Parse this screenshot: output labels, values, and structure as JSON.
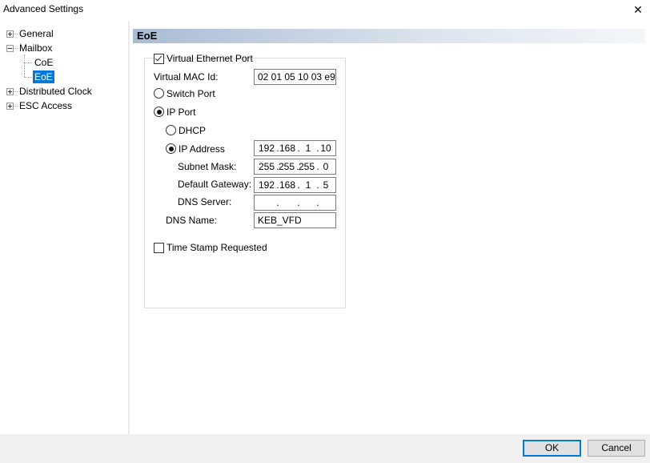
{
  "window": {
    "title": "Advanced Settings",
    "close_glyph": "✕"
  },
  "tree": {
    "general": "General",
    "mailbox": "Mailbox",
    "coe": "CoE",
    "eoe": "EoE",
    "distributed_clock": "Distributed Clock",
    "esc_access": "ESC Access"
  },
  "panel": {
    "header": "EoE"
  },
  "form": {
    "virtual_ethernet_port": "Virtual Ethernet Port",
    "virtual_mac_label": "Virtual MAC Id:",
    "virtual_mac_value": "02 01 05 10 03 e9",
    "switch_port": "Switch Port",
    "ip_port": "IP Port",
    "dhcp": "DHCP",
    "ip_address": "IP Address",
    "ip_address_value": [
      "192",
      "168",
      "1",
      "10"
    ],
    "subnet_mask_label": "Subnet Mask:",
    "subnet_mask_value": [
      "255",
      "255",
      "255",
      "0"
    ],
    "default_gateway_label": "Default Gateway:",
    "default_gateway_value": [
      "192",
      "168",
      "1",
      "5"
    ],
    "dns_server_label": "DNS Server:",
    "dns_server_value": [
      "",
      "",
      "",
      ""
    ],
    "dns_name_label": "DNS Name:",
    "dns_name_value": "KEB_VFD",
    "time_stamp_requested": "Time Stamp Requested",
    "ip_dot": "."
  },
  "buttons": {
    "ok": "OK",
    "cancel": "Cancel"
  },
  "colors": {
    "selection": "#0078d7",
    "header_gradient_start": "#a9bcd4"
  }
}
